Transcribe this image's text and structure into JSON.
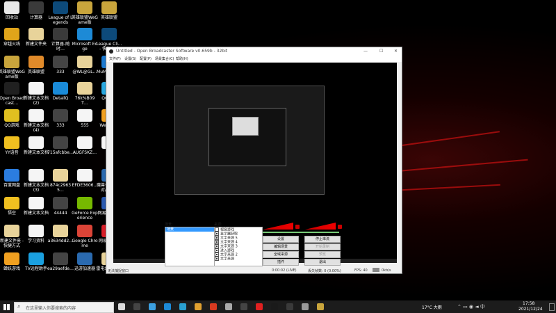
{
  "desktop": {
    "icons": [
      {
        "label": "回收站",
        "color": "#e8e8e8"
      },
      {
        "label": "计算器",
        "color": "#3a3a3a"
      },
      {
        "label": "League of Legends",
        "color": "#0d4a7a"
      },
      {
        "label": "英雄联盟WeGame版",
        "color": "#c9a53c"
      },
      {
        "label": "英雄联盟",
        "color": "#c9a53c"
      },
      {
        "label": "穿越火线",
        "color": "#e0a41a"
      },
      {
        "label": "新建文件夹",
        "color": "#e8d39a"
      },
      {
        "label": "计算器-随时…",
        "color": "#3a3a3a"
      },
      {
        "label": "Microsoft Edge",
        "color": "#1d8ad6"
      },
      {
        "label": "League Cli… - 快捷方式",
        "color": "#0d4a7a"
      },
      {
        "label": "英雄联盟WeGame版",
        "color": "#c9a53c"
      },
      {
        "label": "英雄联盟",
        "color": "#e08a2a"
      },
      {
        "label": "333",
        "color": "#444444"
      },
      {
        "label": "@WL@GL…",
        "color": "#e8d39a"
      },
      {
        "label": "MuMu模拟器",
        "color": "#1c7ad0"
      },
      {
        "label": "Open Broadcast…",
        "color": "#202020"
      },
      {
        "label": "新建文本文档(2)",
        "color": "#f5f5f5"
      },
      {
        "label": "DetailQ",
        "color": "#1a8bd8"
      },
      {
        "label": "76k%B09T…",
        "color": "#e8d39a"
      },
      {
        "label": "QQ游戏",
        "color": "#28a8e0"
      },
      {
        "label": "QQ游戏",
        "color": "#e0c020"
      },
      {
        "label": "新建文本文档(4)",
        "color": "#f5f5f5"
      },
      {
        "label": "333",
        "color": "#444444"
      },
      {
        "label": "555",
        "color": "#f5f5f5"
      },
      {
        "label": "WeGame",
        "color": "#f0a020"
      },
      {
        "label": "YY语音",
        "color": "#f0c020"
      },
      {
        "label": "新建文本文档",
        "color": "#f5f5f5"
      },
      {
        "label": "715afcbbe…",
        "color": "#444444"
      },
      {
        "label": "AUGFSKZ…",
        "color": "#f5f5f5"
      },
      {
        "label": "",
        "color": "#f5f5f5"
      },
      {
        "label": "百度网盘",
        "color": "#2b7de0"
      },
      {
        "label": "新建文本文档(3)",
        "color": "#f5f5f5"
      },
      {
        "label": "874c29635…",
        "color": "#e8d39a"
      },
      {
        "label": "EFDE3606…",
        "color": "#f5f5f5"
      },
      {
        "label": "魔兽争霸官方对战平台",
        "color": "#2a6ab0"
      },
      {
        "label": "悟空",
        "color": "#f0c020"
      },
      {
        "label": "新建文本文档",
        "color": "#f5f5f5"
      },
      {
        "label": "44444",
        "color": "#444444"
      },
      {
        "label": "GeForce Experience",
        "color": "#76b900"
      },
      {
        "label": "网易UU加速器",
        "color": "#2a5ab0"
      },
      {
        "label": "新建文件夹 - 快捷方式",
        "color": "#e8d39a"
      },
      {
        "label": "学习资料",
        "color": "#f5f5f5"
      },
      {
        "label": "a3634dd2…",
        "color": "#e8d39a"
      },
      {
        "label": "Google Chrome",
        "color": "#db4437"
      },
      {
        "label": "网易云音乐",
        "color": "#d81e28"
      },
      {
        "label": "蝉妖游戏",
        "color": "#f0a020"
      },
      {
        "label": "TV远程助手",
        "color": "#1aa0e0"
      },
      {
        "label": "ea29aefde…",
        "color": "#444444"
      },
      {
        "label": "迅游加速器",
        "color": "#2a6ab0"
      },
      {
        "label": "雷电SAM机制",
        "color": "#e8d39a"
      }
    ]
  },
  "obs": {
    "title": "Untitled - Open Broadcaster Software v0.659b - 32bit",
    "menu": [
      "文件(F)",
      "设置(S)",
      "配置(P)",
      "场景集合(C)",
      "帮助(H)"
    ],
    "scenes_label": "场景:",
    "sources_label": "来源:",
    "scenes": [
      "场景"
    ],
    "sources": [
      {
        "label": "视窗游戏",
        "checked": false
      },
      {
        "label": "显示器获取",
        "checked": true
      },
      {
        "label": "文字来源 5",
        "checked": true
      },
      {
        "label": "文字来源 4",
        "checked": true
      },
      {
        "label": "文字来源 3",
        "checked": true
      },
      {
        "label": "进入游戏",
        "checked": true
      },
      {
        "label": "文字来源 2",
        "checked": true
      },
      {
        "label": "文字来源",
        "checked": true
      }
    ],
    "buttons": {
      "settings": "设置",
      "stop_stream": "停止串流",
      "edit_scene": "编辑场景",
      "start_record": "开始录制",
      "global_sources": "全域来源",
      "preview": "预览",
      "plugins": "插件",
      "exit": "退出"
    },
    "status": {
      "left": "无法捕捉窗口",
      "time": "0:00:02 (LIVE)",
      "dropped": "丢失帧数: 0 (0.00%)",
      "fps": "FPS: 40",
      "bitrate": "0kb/s"
    }
  },
  "taskbar": {
    "search_placeholder": "在这里输入你要搜索的内容",
    "weather": "17°C 大雨",
    "time": "17:58",
    "date": "2021/12/24"
  }
}
